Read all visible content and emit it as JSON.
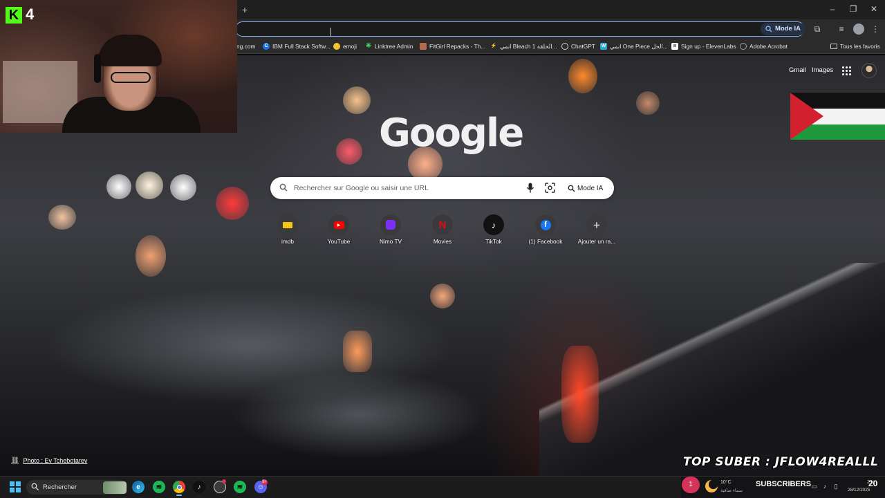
{
  "overlay": {
    "kick_count": "4",
    "top_suber": "TOP SUBER : JFLOW4REALLL",
    "subscribers_label": "SUBSCRIBERS",
    "subscribers_count": "20",
    "notification_count": "1"
  },
  "browser": {
    "new_tab": "+",
    "omnibox_mode": "Mode IA",
    "all_bookmarks": "Tous les favoris",
    "bookmarks": [
      {
        "label": "ng.com",
        "icon": "generic",
        "color": "#2b2b2b"
      },
      {
        "label": "IBM Full Stack Softw...",
        "icon": "c-icon",
        "color": "#1a73e8"
      },
      {
        "label": "emoji",
        "icon": "emoji-icon",
        "color": "#f4c430"
      },
      {
        "label": "Linktree Admin",
        "icon": "linktree-icon",
        "color": "#43e55e"
      },
      {
        "label": "FitGirl Repacks - Th...",
        "icon": "fitgirl-icon",
        "color": "#b36b4b"
      },
      {
        "label": "انمي Bleach الحلقة 1...",
        "icon": "bolt-icon",
        "color": "#f4c430"
      },
      {
        "label": "ChatGPT",
        "icon": "chatgpt-icon",
        "color": "#cfcfcf"
      },
      {
        "label": "انمي One Piece الحل...",
        "icon": "w-icon",
        "color": "#2aa6c9"
      },
      {
        "label": "Sign up - ElevenLabs",
        "icon": "elevenlabs-icon",
        "color": "#ffffff"
      },
      {
        "label": "Adobe Acrobat",
        "icon": "globe-icon",
        "color": "#9aa0a6"
      }
    ]
  },
  "google": {
    "gmail": "Gmail",
    "images": "Images",
    "logo": "Google",
    "search_placeholder": "Rechercher sur Google ou saisir une URL",
    "mode_ia": "Mode IA",
    "shortcuts": [
      {
        "label": "imdb",
        "icon": "imdb-icon",
        "color": "#f5c518"
      },
      {
        "label": "YouTube",
        "icon": "youtube-icon",
        "color": "#ff0000"
      },
      {
        "label": "Nimo TV",
        "icon": "nimo-icon",
        "color": "#7b2ff7"
      },
      {
        "label": "Movies",
        "icon": "netflix-icon",
        "color": "#e50914"
      },
      {
        "label": "TikTok",
        "icon": "tiktok-icon",
        "color": "#000000"
      },
      {
        "label": "(1) Facebook",
        "icon": "facebook-icon",
        "color": "#1877f2"
      },
      {
        "label": "Ajouter un ra...",
        "icon": "plus-icon",
        "color": "#3a3a3c"
      }
    ],
    "photo_credit": "Photo : Ev Tchebotarev"
  },
  "taskbar": {
    "search_label": "Rechercher",
    "apps": [
      {
        "name": "edge",
        "color": "#1fa0e3"
      },
      {
        "name": "spotify",
        "color": "#1db954"
      },
      {
        "name": "chrome",
        "color": "#e8453c"
      },
      {
        "name": "tiktok",
        "color": "#111111"
      },
      {
        "name": "obs",
        "color": "#3a3a3a"
      },
      {
        "name": "spotify-2",
        "color": "#1db954"
      },
      {
        "name": "discord",
        "color": "#5865f2"
      }
    ],
    "discord_badge": "9+",
    "weather_temp": "10°C",
    "weather_desc": "سماء صافية",
    "clock_time": "21:",
    "clock_date": "28/12/2025"
  },
  "colors": {
    "accent": "#8ab4f8",
    "kick_green": "#53fc18",
    "notif_pink": "#d6335a"
  }
}
